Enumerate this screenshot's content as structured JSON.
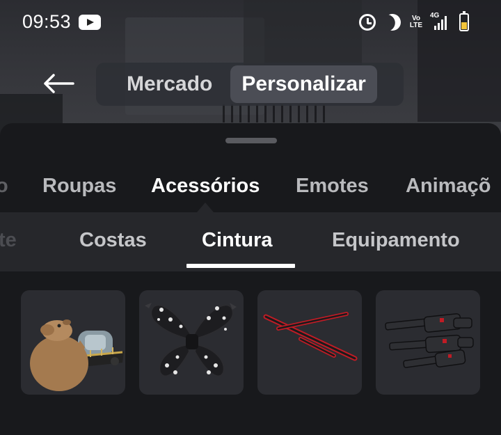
{
  "status_bar": {
    "time": "09:53",
    "volte_label": "Vo\nLTE",
    "network_label": "4G",
    "icons": [
      "youtube-icon",
      "alarm-icon",
      "moon-icon",
      "volte-icon",
      "signal-icon",
      "battery-icon"
    ]
  },
  "top_nav": {
    "segments": [
      {
        "label": "Mercado",
        "active": false
      },
      {
        "label": "Personalizar",
        "active": true
      }
    ]
  },
  "category_tabs": [
    {
      "label": "o",
      "state": "partial"
    },
    {
      "label": "Roupas",
      "state": "normal"
    },
    {
      "label": "Acessórios",
      "state": "active"
    },
    {
      "label": "Emotes",
      "state": "normal"
    },
    {
      "label": "Animaçõ",
      "state": "partial"
    }
  ],
  "sub_tabs": [
    {
      "label": "te",
      "state": "partial"
    },
    {
      "label": "Costas",
      "state": "normal"
    },
    {
      "label": "Cintura",
      "state": "active"
    },
    {
      "label": "Equipamento",
      "state": "normal"
    }
  ],
  "items": [
    {
      "name": "capybara-vehicle-item"
    },
    {
      "name": "bow-item"
    },
    {
      "name": "red-swords-item"
    },
    {
      "name": "miniguns-item"
    }
  ],
  "colors": {
    "sheet_background": "#18191c",
    "subbar_background": "#26272b",
    "card_background": "#2b2c31",
    "active_text": "#ffffff"
  }
}
